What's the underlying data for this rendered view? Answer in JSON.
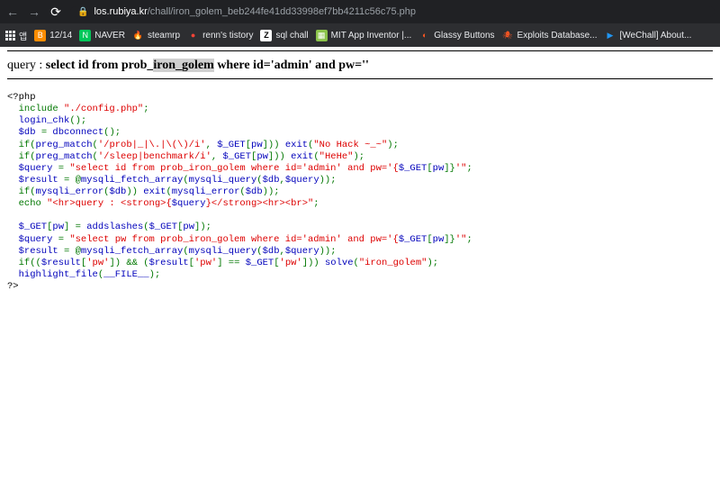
{
  "toolbar": {
    "url_host": "los.rubiya.kr",
    "url_path": "/chall/iron_golem_beb244fe41dd33998ef7bb4211c56c75.php"
  },
  "bookmarks": {
    "items": [
      {
        "label": "앱",
        "icon_bg": "#fb8c00",
        "icon_text": "B"
      },
      {
        "label": "12/14",
        "icon_bg": "#fb8c00",
        "icon_text": "B"
      },
      {
        "label": "NAVER",
        "icon_bg": "#03c75a",
        "icon_text": "N"
      },
      {
        "label": "steamrp",
        "icon_bg": "#000",
        "icon_text": "🔥"
      },
      {
        "label": "renn's tistory",
        "icon_bg": "#000",
        "icon_text": "●"
      },
      {
        "label": "sql chall",
        "icon_bg": "#000",
        "icon_text": "Z"
      },
      {
        "label": "MIT App Inventor |...",
        "icon_bg": "#8bc34a",
        "icon_text": "▦"
      },
      {
        "label": "Glassy Buttons",
        "icon_bg": "#ff5722",
        "icon_text": "◐"
      },
      {
        "label": "Exploits Database...",
        "icon_bg": "#ff5722",
        "icon_text": "🕷"
      },
      {
        "label": "[WeChall] About...",
        "icon_bg": "#2196f3",
        "icon_text": "▶"
      }
    ]
  },
  "query": {
    "label": "query : ",
    "sql_pre": "select id from prob_",
    "sql_hilite": "iron_golem",
    "sql_post": " where id='admin' and pw=''"
  },
  "code": {
    "l1": "<?php",
    "l2a": "  include ",
    "l2b": "\"./config.php\"",
    "l2c": ";",
    "l3a": "  login_chk",
    "l3b": "();",
    "l4a": "  $db ",
    "l4b": "= ",
    "l4c": "dbconnect",
    "l4d": "();",
    "l5a": "  if(",
    "l5b": "preg_match",
    "l5c": "(",
    "l5d": "'/prob|_|\\.|\\(\\)/i'",
    "l5e": ", ",
    "l5f": "$_GET",
    "l5g": "[",
    "l5h": "pw",
    "l5i": "])) ",
    "l5j": "exit",
    "l5k": "(",
    "l5l": "\"No Hack ~_~\"",
    "l5m": ");",
    "l6a": "  if(",
    "l6b": "preg_match",
    "l6c": "(",
    "l6d": "'/sleep|benchmark/i'",
    "l6e": ", ",
    "l6f": "$_GET",
    "l6g": "[",
    "l6h": "pw",
    "l6i": "])) ",
    "l6j": "exit",
    "l6k": "(",
    "l6l": "\"HeHe\"",
    "l6m": ");",
    "l7a": "  $query ",
    "l7b": "= ",
    "l7c": "\"select id from prob_iron_golem where id='admin' and pw='",
    "l7d": "{",
    "l7e": "$_GET",
    "l7f": "[",
    "l7g": "pw",
    "l7h": "]}",
    "l7i": "'\"",
    "l7j": ";",
    "l8a": "  $result ",
    "l8b": "= @",
    "l8c": "mysqli_fetch_array",
    "l8d": "(",
    "l8e": "mysqli_query",
    "l8f": "(",
    "l8g": "$db",
    "l8h": ",",
    "l8i": "$query",
    "l8j": "));",
    "l9a": "  if(",
    "l9b": "mysqli_error",
    "l9c": "(",
    "l9d": "$db",
    "l9e": ")) ",
    "l9f": "exit",
    "l9g": "(",
    "l9h": "mysqli_error",
    "l9i": "(",
    "l9j": "$db",
    "l9k": "));",
    "l10a": "  echo ",
    "l10b": "\"<hr>query : <strong>",
    "l10c": "{",
    "l10d": "$query",
    "l10e": "}",
    "l10f": "</strong><hr><br>\"",
    "l10g": ";",
    "l12a": "  $_GET",
    "l12b": "[",
    "l12c": "pw",
    "l12d": "] = ",
    "l12e": "addslashes",
    "l12f": "(",
    "l12g": "$_GET",
    "l12h": "[",
    "l12i": "pw",
    "l12j": "]);",
    "l13a": "  $query ",
    "l13b": "= ",
    "l13c": "\"select pw from prob_iron_golem where id='admin' and pw='",
    "l13d": "{",
    "l13e": "$_GET",
    "l13f": "[",
    "l13g": "pw",
    "l13h": "]}",
    "l13i": "'\"",
    "l13j": ";",
    "l14a": "  $result ",
    "l14b": "= @",
    "l14c": "mysqli_fetch_array",
    "l14d": "(",
    "l14e": "mysqli_query",
    "l14f": "(",
    "l14g": "$db",
    "l14h": ",",
    "l14i": "$query",
    "l14j": "));",
    "l15a": "  if((",
    "l15b": "$result",
    "l15c": "[",
    "l15d": "'pw'",
    "l15e": "]) && (",
    "l15f": "$result",
    "l15g": "[",
    "l15h": "'pw'",
    "l15i": "] == ",
    "l15j": "$_GET",
    "l15k": "[",
    "l15l": "'pw'",
    "l15m": "])) ",
    "l15n": "solve",
    "l15o": "(",
    "l15p": "\"iron_golem\"",
    "l15q": ");",
    "l16a": "  highlight_file",
    "l16b": "(",
    "l16c": "__FILE__",
    "l16d": ");",
    "l17": "?>"
  }
}
